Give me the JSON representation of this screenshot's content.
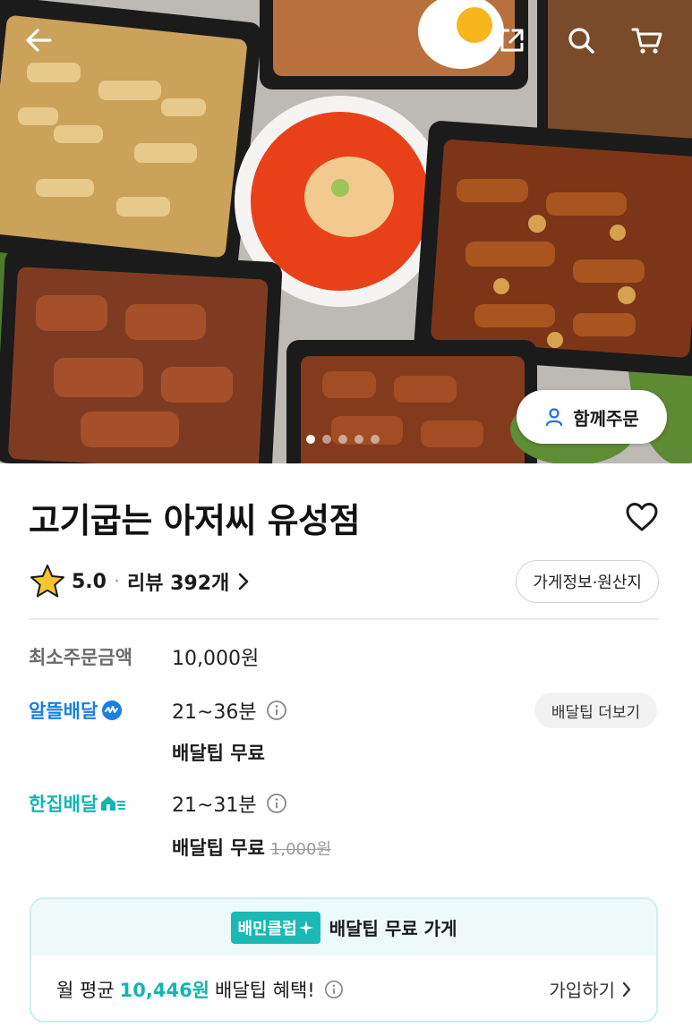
{
  "hero": {
    "together_order_label": "함께주문",
    "image_count": 5,
    "active_index": 0
  },
  "store": {
    "name": "고기굽는 아저씨 유성점",
    "rating": "5.0",
    "review_label": "리뷰 392개",
    "info_button_label": "가게정보·원산지",
    "favorited": false
  },
  "order_info": {
    "min_order_label": "최소주문금액",
    "min_order_value": "10,000원",
    "delivery_more_label": "배달팁 더보기",
    "options": [
      {
        "name": "알뜰배달",
        "time": "21~36분",
        "fee": "배달팁 무료",
        "original_fee": ""
      },
      {
        "name": "한집배달",
        "time": "21~31분",
        "fee": "배달팁 무료",
        "original_fee": "1,000원"
      }
    ]
  },
  "club": {
    "badge": "배민클럽",
    "title": "배달팁 무료 가게",
    "prefix": "월 평균",
    "amount": "10,446원",
    "suffix": "배달팁 혜택!",
    "join_label": "가입하기"
  },
  "colors": {
    "alddeul_blue": "#1a7fe0",
    "hanjip_teal": "#13b5b1",
    "club_teal": "#1bb8b4",
    "star": "#f7c531"
  },
  "icons": [
    "back-arrow-icon",
    "share-icon",
    "search-icon",
    "cart-icon",
    "person-icon",
    "heart-icon",
    "star-icon",
    "chevron-right-icon",
    "info-icon"
  ]
}
